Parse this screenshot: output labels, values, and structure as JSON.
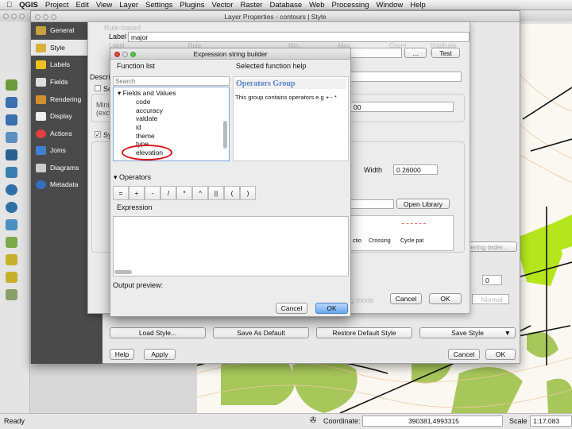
{
  "menubar": {
    "app": "QGIS",
    "items": [
      "Project",
      "Edit",
      "View",
      "Layer",
      "Settings",
      "Plugins",
      "Vector",
      "Raster",
      "Database",
      "Web",
      "Processing",
      "Window",
      "Help"
    ]
  },
  "layer_props": {
    "title": "Layer Properties - contours | Style",
    "sidebar": [
      {
        "label": "General",
        "icon": "general-icon"
      },
      {
        "label": "Style",
        "icon": "style-icon"
      },
      {
        "label": "Labels",
        "icon": "labels-icon"
      },
      {
        "label": "Fields",
        "icon": "fields-icon"
      },
      {
        "label": "Rendering",
        "icon": "rendering-icon"
      },
      {
        "label": "Display",
        "icon": "display-icon"
      },
      {
        "label": "Actions",
        "icon": "actions-icon"
      },
      {
        "label": "Joins",
        "icon": "joins-icon"
      },
      {
        "label": "Diagrams",
        "icon": "diagrams-icon"
      },
      {
        "label": "Metadata",
        "icon": "metadata-icon"
      }
    ],
    "bottom_buttons": {
      "load": "Load Style...",
      "save_default": "Save As Default",
      "restore": "Restore Default Style",
      "save": "Save Style",
      "help": "Help",
      "apply": "Apply",
      "cancel": "Cancel",
      "ok": "OK"
    },
    "rendering_order": "Rendering order..."
  },
  "rule_dialog": {
    "label_label": "Label",
    "label_value": "major",
    "rule_header": "Rule-based",
    "columns": [
      "Label",
      "Rule",
      "Min. scale",
      "Max. scale",
      "Count",
      "Duplicate count"
    ],
    "ellipsis": "...",
    "test": "Test",
    "description_label": "Descri",
    "scale_check": "Sc",
    "min_label": "Mini",
    "exc_label": "(exc",
    "combo_value": "00",
    "symbol_check": "Sy",
    "width_label": "Width",
    "width_value": "0.26000",
    "open_library": "Open Library",
    "symbols": [
      "ctio",
      "Crossing",
      "Cycle pat"
    ],
    "spin_value": "0",
    "cancel": "Cancel",
    "ok": "OK",
    "blend_label": "ting mode",
    "blend_value": "Normal"
  },
  "expr": {
    "title": "Expression string builder",
    "function_list": "Function list",
    "help_title": "Selected function help",
    "search_placeholder": "Search",
    "group": "Fields and Values",
    "fields": [
      "code",
      "accuracy",
      "valdate",
      "id",
      "theme",
      "type",
      "elevation"
    ],
    "help_heading": "Operators Group",
    "help_text": "This group contains operators e.g + - *",
    "operators_label": "Operators",
    "operators": [
      "=",
      "+",
      "-",
      "/",
      "*",
      "^",
      "||",
      "(",
      ")"
    ],
    "expression_label": "Expression",
    "expression_value": "",
    "output_preview": "Output preview:",
    "cancel": "Cancel",
    "ok": "OK",
    "highlight_color": "#d9141a"
  },
  "status": {
    "ready": "Ready",
    "coord_label": "Coordinate:",
    "coord_value": "390381,4993315",
    "scale_label": "Scale",
    "scale_value": "1:17,083"
  }
}
